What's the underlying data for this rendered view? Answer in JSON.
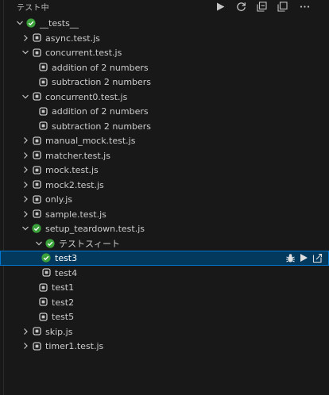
{
  "header": {
    "title": "テスト中"
  },
  "toolbar": {
    "run_all": "play-icon",
    "refresh": "refresh-icon",
    "collapse": "collapse-all-icon",
    "open_output": "copy-icon",
    "more": "ellipsis-icon"
  },
  "tree": [
    {
      "label": "__tests__",
      "depth": 0,
      "chevron": "down",
      "status": "passed"
    },
    {
      "label": "async.test.js",
      "depth": 1,
      "chevron": "right",
      "status": "unset"
    },
    {
      "label": "concurrent.test.js",
      "depth": 1,
      "chevron": "down",
      "status": "unset"
    },
    {
      "label": "addition of 2 numbers",
      "depth": 2,
      "chevron": "none",
      "status": "unset"
    },
    {
      "label": "subtraction 2 numbers",
      "depth": 2,
      "chevron": "none",
      "status": "unset"
    },
    {
      "label": "concurrent0.test.js",
      "depth": 1,
      "chevron": "down",
      "status": "unset"
    },
    {
      "label": "addition of 2 numbers",
      "depth": 2,
      "chevron": "none",
      "status": "unset"
    },
    {
      "label": "subtraction 2 numbers",
      "depth": 2,
      "chevron": "none",
      "status": "unset"
    },
    {
      "label": "manual_mock.test.js",
      "depth": 1,
      "chevron": "right",
      "status": "unset"
    },
    {
      "label": "matcher.test.js",
      "depth": 1,
      "chevron": "right",
      "status": "unset"
    },
    {
      "label": "mock.test.js",
      "depth": 1,
      "chevron": "right",
      "status": "unset"
    },
    {
      "label": "mock2.test.js",
      "depth": 1,
      "chevron": "right",
      "status": "unset"
    },
    {
      "label": "only.js",
      "depth": 1,
      "chevron": "right",
      "status": "unset"
    },
    {
      "label": "sample.test.js",
      "depth": 1,
      "chevron": "right",
      "status": "unset"
    },
    {
      "label": "setup_teardown.test.js",
      "depth": 1,
      "chevron": "down",
      "status": "passed"
    },
    {
      "label": "テストスィート",
      "depth": 2,
      "chevron": "down",
      "status": "passed"
    },
    {
      "label": "test3",
      "depth": 3,
      "chevron": "none",
      "status": "passed",
      "selected": true
    },
    {
      "label": "test4",
      "depth": 3,
      "chevron": "none",
      "status": "unset"
    },
    {
      "label": "test1",
      "depth": 2,
      "chevron": "none",
      "status": "unset"
    },
    {
      "label": "test2",
      "depth": 2,
      "chevron": "none",
      "status": "unset"
    },
    {
      "label": "test5",
      "depth": 2,
      "chevron": "none",
      "status": "unset"
    },
    {
      "label": "skip.js",
      "depth": 1,
      "chevron": "right",
      "status": "unset"
    },
    {
      "label": "timer1.test.js",
      "depth": 1,
      "chevron": "right",
      "status": "unset"
    }
  ],
  "row_actions": [
    "debug-icon",
    "run-icon",
    "go-to-test-icon"
  ],
  "colors": {
    "background": "#181818",
    "passed": "#3ba13b",
    "unset": "#c5c5c5",
    "selected_bg": "#04395e",
    "selected_border": "#0078d4"
  }
}
